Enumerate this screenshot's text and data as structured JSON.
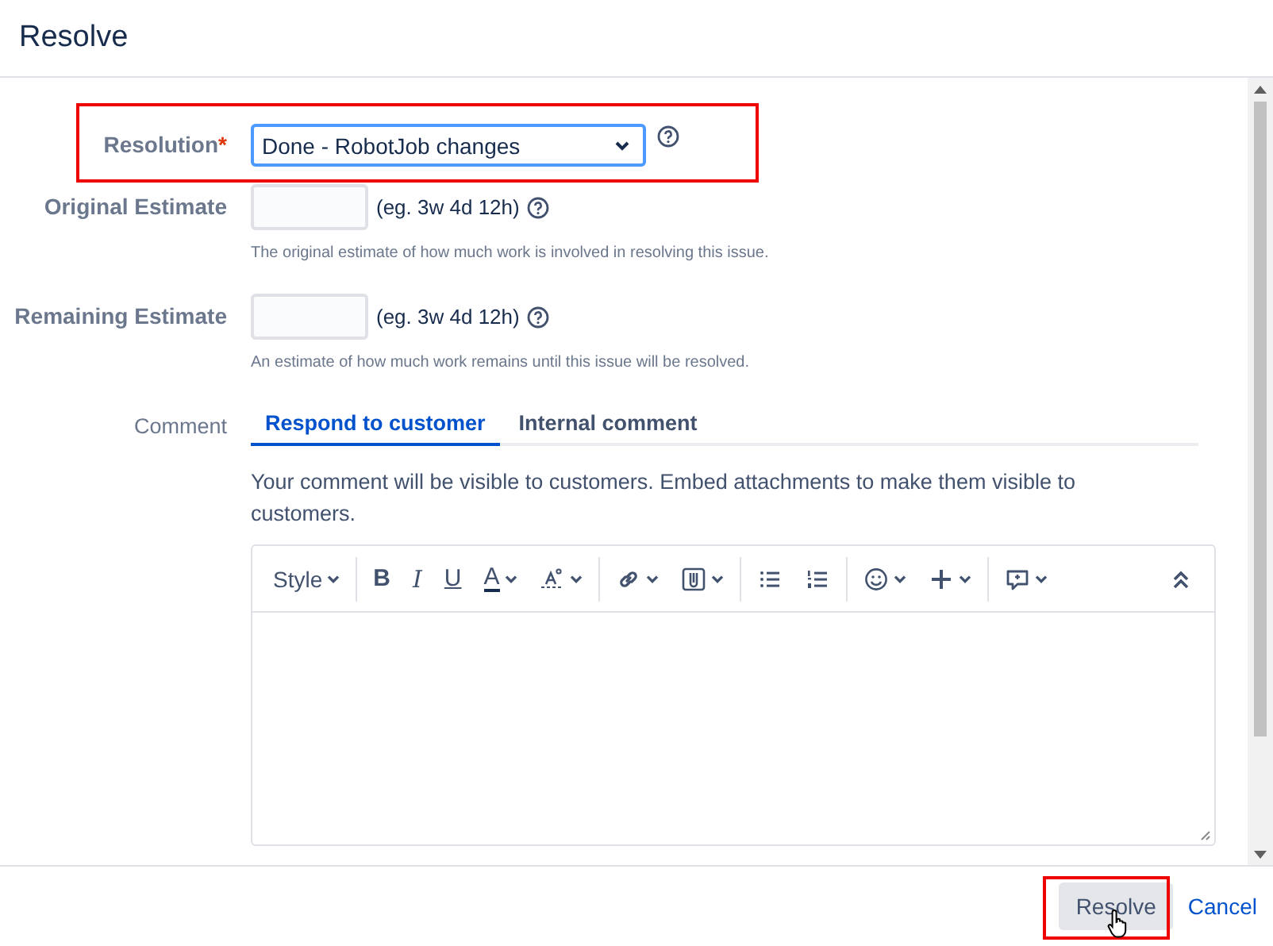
{
  "dialog": {
    "title": "Resolve"
  },
  "resolution": {
    "label": "Resolution",
    "required_mark": "*",
    "value": "Done - RobotJob changes",
    "highlighted": true
  },
  "estimates": [
    {
      "label": "Original Estimate",
      "hint": "(eg. 3w 4d 12h)",
      "description": "The original estimate of how much work is involved in resolving this issue."
    },
    {
      "label": "Remaining Estimate",
      "hint": "(eg. 3w 4d 12h)",
      "description": "An estimate of how much work remains until this issue will be resolved."
    }
  ],
  "comment": {
    "label": "Comment",
    "tabs": [
      {
        "label": "Respond to customer",
        "selected": true
      },
      {
        "label": "Internal comment",
        "selected": false
      }
    ],
    "notice": "Your comment will be visible to customers. Embed attachments to make them visible to customers.",
    "toolbar": [
      {
        "kind": "style",
        "label": "Style"
      },
      {
        "kind": "bold",
        "label": "B"
      },
      {
        "kind": "italic",
        "label": "I"
      },
      {
        "kind": "underline",
        "label": "U"
      },
      {
        "kind": "color",
        "label": "A"
      },
      {
        "kind": "format"
      },
      {
        "kind": "link"
      },
      {
        "kind": "attachment"
      },
      {
        "kind": "bullets"
      },
      {
        "kind": "numbers"
      },
      {
        "kind": "emoji"
      },
      {
        "kind": "plus"
      },
      {
        "kind": "feedback"
      },
      {
        "kind": "collapse"
      }
    ]
  },
  "footer": {
    "primary": {
      "label": "Resolve",
      "highlighted": true
    },
    "cancel": "Cancel"
  }
}
